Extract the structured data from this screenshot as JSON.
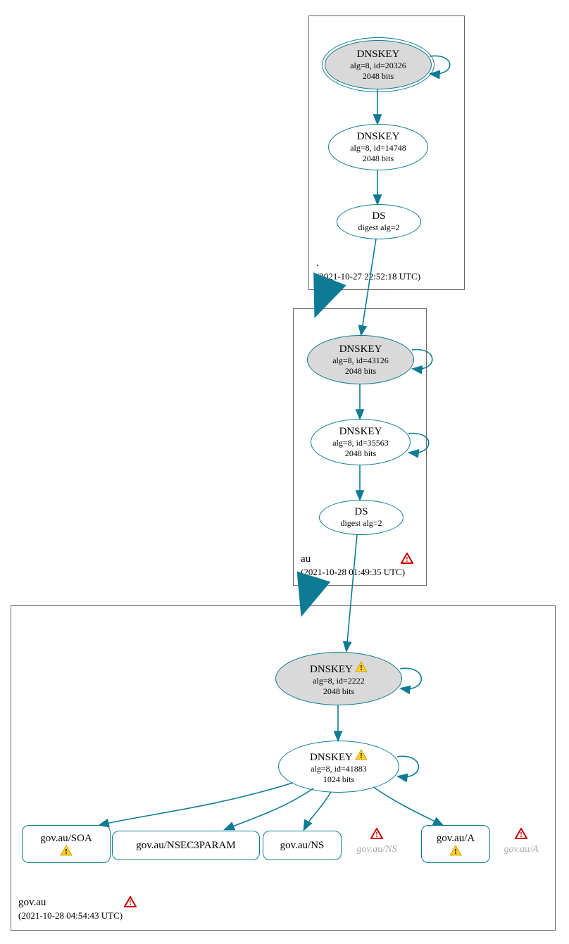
{
  "zones": {
    "root": {
      "label": ".",
      "timestamp": "(2021-10-27 22:52:18 UTC)",
      "nodes": {
        "ksk": {
          "title": "DNSKEY",
          "line1": "alg=8, id=20326",
          "line2": "2048 bits"
        },
        "zsk": {
          "title": "DNSKEY",
          "line1": "alg=8, id=14748",
          "line2": "2048 bits"
        },
        "ds": {
          "title": "DS",
          "line1": "digest alg=2"
        }
      }
    },
    "au": {
      "label": "au",
      "timestamp": "(2021-10-28 01:49:35 UTC)",
      "has_error": true,
      "nodes": {
        "ksk": {
          "title": "DNSKEY",
          "line1": "alg=8, id=43126",
          "line2": "2048 bits"
        },
        "zsk": {
          "title": "DNSKEY",
          "line1": "alg=8, id=35563",
          "line2": "2048 bits"
        },
        "ds": {
          "title": "DS",
          "line1": "digest alg=2"
        }
      }
    },
    "govau": {
      "label": "gov.au",
      "timestamp": "(2021-10-28 04:54:43 UTC)",
      "has_error": true,
      "nodes": {
        "ksk": {
          "title": "DNSKEY",
          "line1": "alg=8, id=2222",
          "line2": "2048 bits",
          "warn": true
        },
        "zsk": {
          "title": "DNSKEY",
          "line1": "alg=8, id=41883",
          "line2": "1024 bits",
          "warn": true
        }
      },
      "rrsets": {
        "soa": {
          "label": "gov.au/SOA",
          "warn": true
        },
        "nsec3param": {
          "label": "gov.au/NSEC3PARAM"
        },
        "ns": {
          "label": "gov.au/NS"
        },
        "ns_ghost": {
          "label": "gov.au/NS"
        },
        "a": {
          "label": "gov.au/A",
          "warn": true
        },
        "a_ghost": {
          "label": "gov.au/A"
        }
      }
    }
  },
  "chart_data": {
    "type": "dnssec-auth-graph",
    "zones": [
      {
        "name": ".",
        "timestamp": "2021-10-27 22:52:18 UTC",
        "keys": [
          {
            "role": "KSK",
            "type": "DNSKEY",
            "alg": 8,
            "id": 20326,
            "bits": 2048,
            "trust_anchor": true
          },
          {
            "role": "ZSK",
            "type": "DNSKEY",
            "alg": 8,
            "id": 14748,
            "bits": 2048
          }
        ],
        "ds": [
          {
            "digest_alg": 2,
            "covers": "au"
          }
        ]
      },
      {
        "name": "au",
        "timestamp": "2021-10-28 01:49:35 UTC",
        "status": "error",
        "keys": [
          {
            "role": "KSK",
            "type": "DNSKEY",
            "alg": 8,
            "id": 43126,
            "bits": 2048
          },
          {
            "role": "ZSK",
            "type": "DNSKEY",
            "alg": 8,
            "id": 35563,
            "bits": 2048
          }
        ],
        "ds": [
          {
            "digest_alg": 2,
            "covers": "gov.au"
          }
        ]
      },
      {
        "name": "gov.au",
        "timestamp": "2021-10-28 04:54:43 UTC",
        "status": "error",
        "keys": [
          {
            "role": "KSK",
            "type": "DNSKEY",
            "alg": 8,
            "id": 2222,
            "bits": 2048,
            "status": "warning"
          },
          {
            "role": "ZSK",
            "type": "DNSKEY",
            "alg": 8,
            "id": 41883,
            "bits": 1024,
            "status": "warning"
          }
        ],
        "rrsets": [
          {
            "name": "gov.au/SOA",
            "status": "warning"
          },
          {
            "name": "gov.au/NSEC3PARAM"
          },
          {
            "name": "gov.au/NS"
          },
          {
            "name": "gov.au/NS",
            "status": "error",
            "unsigned": true
          },
          {
            "name": "gov.au/A",
            "status": "warning"
          },
          {
            "name": "gov.au/A",
            "status": "error",
            "unsigned": true
          }
        ]
      }
    ],
    "edges": [
      {
        "from": ".KSK",
        "to": ".KSK",
        "type": "self-sign"
      },
      {
        "from": ".KSK",
        "to": ".ZSK",
        "type": "sign"
      },
      {
        "from": ".ZSK",
        "to": ".DS",
        "type": "sign"
      },
      {
        "from": ".DS",
        "to": "au.KSK",
        "type": "delegation"
      },
      {
        "from": ".",
        "to": "au",
        "type": "zone-delegation"
      },
      {
        "from": "au.KSK",
        "to": "au.KSK",
        "type": "self-sign"
      },
      {
        "from": "au.KSK",
        "to": "au.ZSK",
        "type": "sign"
      },
      {
        "from": "au.ZSK",
        "to": "au.ZSK",
        "type": "self-sign"
      },
      {
        "from": "au.ZSK",
        "to": "au.DS",
        "type": "sign"
      },
      {
        "from": "au.DS",
        "to": "gov.au.KSK",
        "type": "delegation"
      },
      {
        "from": "au",
        "to": "gov.au",
        "type": "zone-delegation"
      },
      {
        "from": "gov.au.KSK",
        "to": "gov.au.KSK",
        "type": "self-sign"
      },
      {
        "from": "gov.au.KSK",
        "to": "gov.au.ZSK",
        "type": "sign"
      },
      {
        "from": "gov.au.ZSK",
        "to": "gov.au.ZSK",
        "type": "self-sign"
      },
      {
        "from": "gov.au.ZSK",
        "to": "gov.au/SOA",
        "type": "sign"
      },
      {
        "from": "gov.au.ZSK",
        "to": "gov.au/NSEC3PARAM",
        "type": "sign"
      },
      {
        "from": "gov.au.ZSK",
        "to": "gov.au/NS",
        "type": "sign"
      },
      {
        "from": "gov.au.ZSK",
        "to": "gov.au/A",
        "type": "sign"
      }
    ]
  }
}
